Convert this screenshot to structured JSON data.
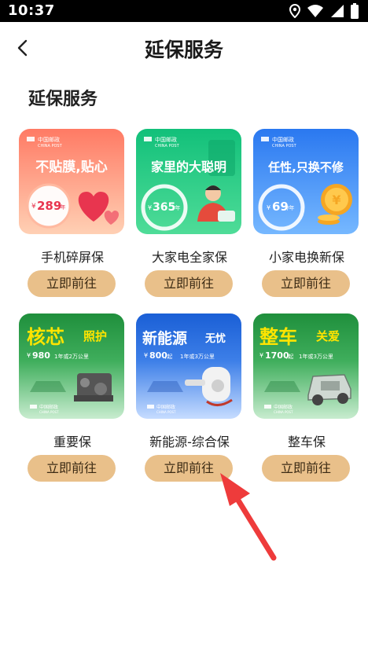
{
  "status_bar": {
    "time": "10:37",
    "icons": [
      "location-icon",
      "wifi-icon",
      "signal-icon",
      "battery-icon"
    ]
  },
  "nav": {
    "title": "延保服务",
    "back_icon": "chevron-left-icon"
  },
  "section": {
    "title": "延保服务"
  },
  "brand": {
    "name_cn": "中国邮政",
    "name_en": "CHINA POST"
  },
  "products": [
    {
      "label": "手机碎屏保",
      "button": "立即前往",
      "banner": {
        "slogan": "不贴膜,贴心",
        "price": "289",
        "price_prefix": "¥",
        "price_unit": "/年"
      },
      "colors": {
        "from": "#ff7a64",
        "to": "#ffc6a8",
        "accent": "#e8354f"
      }
    },
    {
      "label": "大家电全家保",
      "button": "立即前往",
      "banner": {
        "slogan": "家里的大聪明",
        "price": "365",
        "price_prefix": "¥",
        "price_unit": "/年"
      },
      "colors": {
        "from": "#12c07a",
        "to": "#5ce3a2",
        "accent": "#0a8f5a"
      }
    },
    {
      "label": "小家电换新保",
      "button": "立即前往",
      "banner": {
        "slogan": "任性,只换不修",
        "price": "69",
        "price_prefix": "¥",
        "price_unit": "/年"
      },
      "colors": {
        "from": "#2a78f0",
        "to": "#6fb3ff",
        "accent": "#f5a623"
      }
    },
    {
      "label": "重要保",
      "button": "立即前往",
      "banner": {
        "title_main": "核芯",
        "title_sub": "照护",
        "price": "980",
        "price_prefix": "¥",
        "price_note": "1年或2万公里"
      },
      "colors": {
        "from": "#1f8f3c",
        "to": "#b9e6c3",
        "accent": "#ffe400"
      }
    },
    {
      "label": "新能源-综合保",
      "button": "立即前往",
      "banner": {
        "title_main": "新能源",
        "title_sub": "无忧",
        "price": "800",
        "price_prefix": "¥",
        "price_unit": "/起",
        "price_note": "1年或3万公里"
      },
      "colors": {
        "from": "#1a5fd6",
        "to": "#bcd6ff",
        "accent": "#ffffff"
      }
    },
    {
      "label": "整车保",
      "button": "立即前往",
      "banner": {
        "title_main": "整车",
        "title_sub": "关爱",
        "price": "1700",
        "price_prefix": "¥",
        "price_unit": "/起",
        "price_note": "1年或3万公里"
      },
      "colors": {
        "from": "#1f8f3c",
        "to": "#b9e6c3",
        "accent": "#ffe400"
      }
    }
  ],
  "annotation": {
    "arrow_color": "#ee3b3b",
    "points_to": "新能源-综合保 button"
  }
}
